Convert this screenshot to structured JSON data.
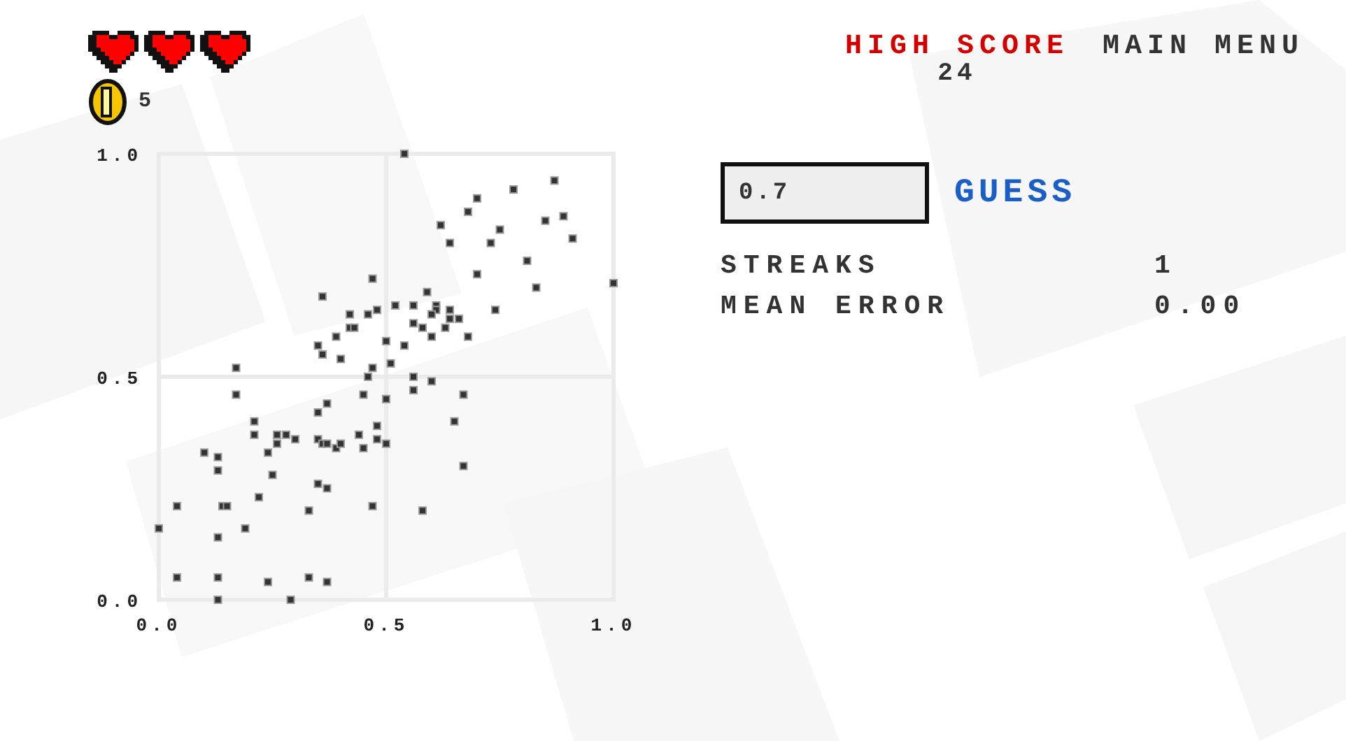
{
  "lives": [
    {
      "filled": true
    },
    {
      "filled": true
    },
    {
      "filled": true
    }
  ],
  "coins": "5",
  "high_score": {
    "label": "HIGH SCORE",
    "value": "24"
  },
  "main_menu": "MAIN MENU",
  "guess": {
    "value": "0.7",
    "button": "GUESS"
  },
  "stats": [
    {
      "label": "STREAKS",
      "value": "1"
    },
    {
      "label": "MEAN ERROR",
      "value": "0.00"
    }
  ],
  "chart_data": {
    "type": "scatter",
    "xlim": [
      0,
      1
    ],
    "ylim": [
      0,
      1
    ],
    "xticks": [
      {
        "value": 0,
        "label": "0.0"
      },
      {
        "value": 0.5,
        "label": "0.5"
      },
      {
        "value": 1,
        "label": "1.0"
      }
    ],
    "yticks": [
      {
        "value": 0,
        "label": "0.0"
      },
      {
        "value": 0.5,
        "label": "0.5"
      },
      {
        "value": 1,
        "label": "1.0"
      }
    ],
    "x": [
      0.54,
      0.87,
      0.78,
      0.7,
      0.68,
      0.62,
      0.85,
      0.89,
      0.75,
      0.73,
      0.64,
      0.91,
      0.81,
      0.7,
      1.0,
      0.83,
      0.59,
      0.52,
      0.48,
      0.56,
      0.61,
      0.61,
      0.6,
      0.64,
      0.74,
      0.64,
      0.66,
      0.63,
      0.56,
      0.58,
      0.6,
      0.68,
      0.5,
      0.54,
      0.51,
      0.56,
      0.6,
      0.47,
      0.36,
      0.42,
      0.46,
      0.42,
      0.43,
      0.39,
      0.35,
      0.36,
      0.4,
      0.47,
      0.17,
      0.46,
      0.17,
      0.45,
      0.5,
      0.37,
      0.35,
      0.21,
      0.48,
      0.21,
      0.26,
      0.28,
      0.3,
      0.44,
      0.48,
      0.26,
      0.35,
      0.36,
      0.37,
      0.39,
      0.4,
      0.45,
      0.5,
      0.1,
      0.13,
      0.24,
      0.13,
      0.25,
      0.35,
      0.37,
      0.04,
      0.14,
      0.15,
      0.22,
      0.33,
      0.47,
      0.0,
      0.19,
      0.13,
      0.04,
      0.13,
      0.24,
      0.33,
      0.37,
      0.13,
      0.29,
      0.56,
      0.67,
      0.5,
      0.65,
      0.67,
      0.58
    ],
    "series": [
      {
        "color": "#333333",
        "values": [
          1.0,
          0.94,
          0.92,
          0.9,
          0.87,
          0.84,
          0.85,
          0.86,
          0.83,
          0.8,
          0.8,
          0.81,
          0.76,
          0.73,
          0.71,
          0.7,
          0.69,
          0.66,
          0.65,
          0.66,
          0.66,
          0.65,
          0.64,
          0.65,
          0.65,
          0.63,
          0.63,
          0.61,
          0.62,
          0.61,
          0.59,
          0.59,
          0.58,
          0.57,
          0.53,
          0.5,
          0.49,
          0.72,
          0.68,
          0.64,
          0.64,
          0.61,
          0.61,
          0.59,
          0.57,
          0.55,
          0.54,
          0.52,
          0.52,
          0.5,
          0.46,
          0.46,
          0.45,
          0.44,
          0.42,
          0.4,
          0.39,
          0.37,
          0.37,
          0.37,
          0.36,
          0.37,
          0.36,
          0.35,
          0.36,
          0.35,
          0.35,
          0.34,
          0.35,
          0.34,
          0.35,
          0.33,
          0.32,
          0.33,
          0.29,
          0.28,
          0.26,
          0.25,
          0.21,
          0.21,
          0.21,
          0.23,
          0.2,
          0.21,
          0.16,
          0.16,
          0.14,
          0.05,
          0.05,
          0.04,
          0.05,
          0.04,
          0.0,
          0.0,
          0.47,
          0.46,
          0.45,
          0.4,
          0.3,
          0.2
        ]
      }
    ]
  }
}
